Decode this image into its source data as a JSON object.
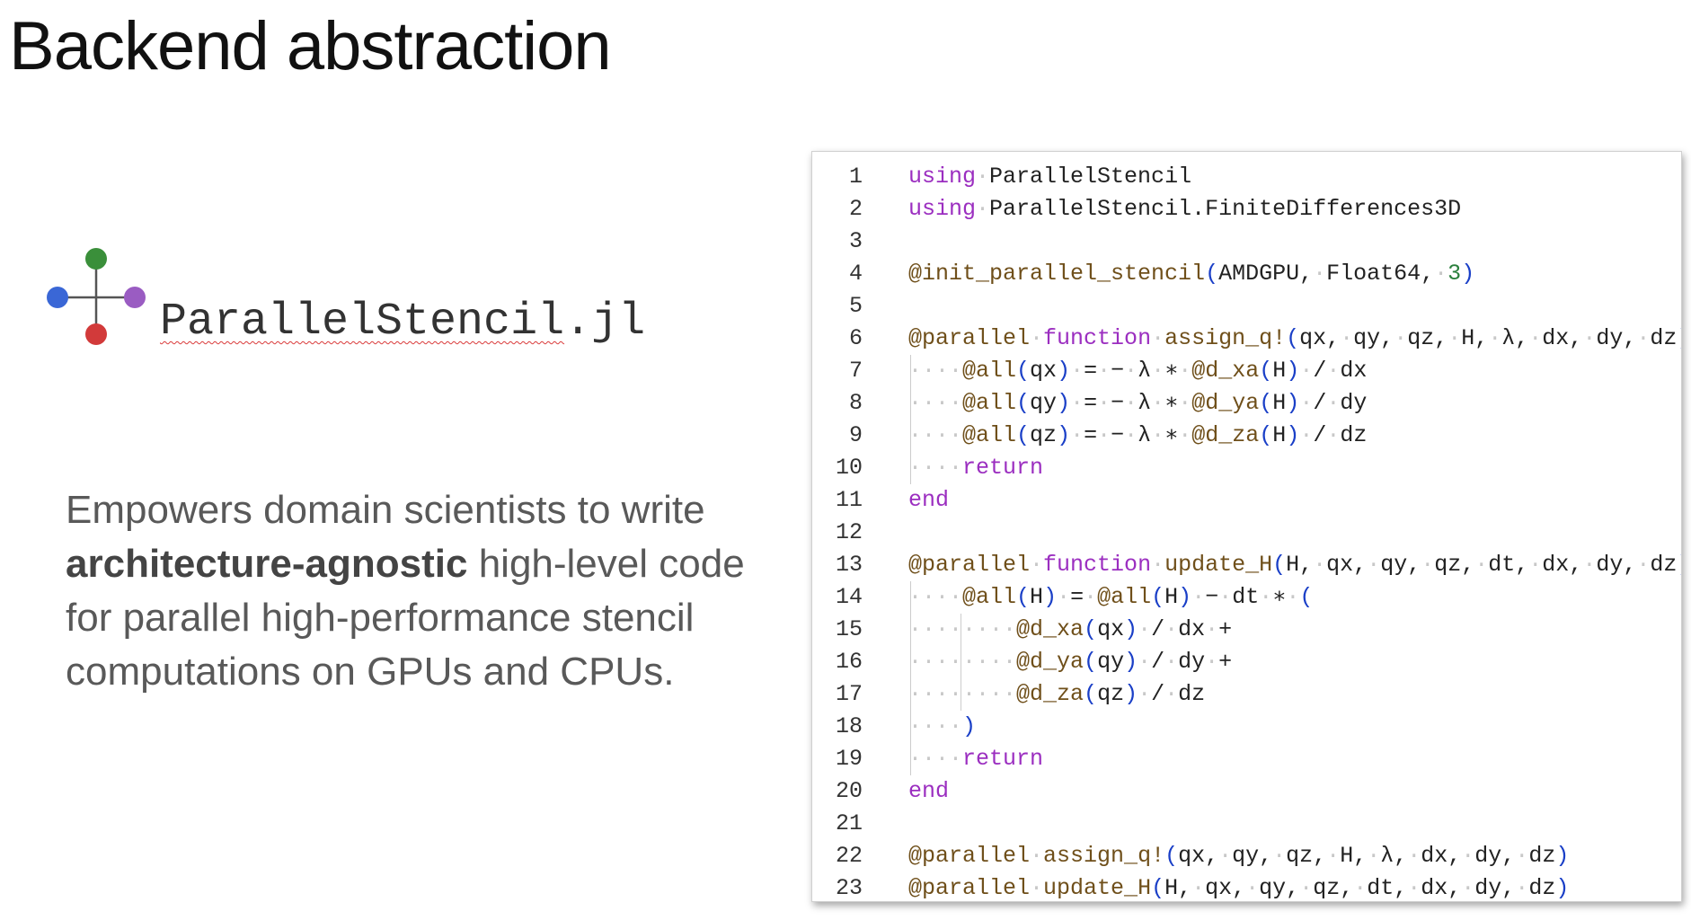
{
  "slide": {
    "title": "Backend abstraction",
    "logo_text_main": "ParallelStencil",
    "logo_text_ext": ".jl",
    "description_pre": "Empowers domain scientists to write ",
    "description_bold": "architecture-agnostic",
    "description_post": " high-level code for parallel high-performance stencil computations on GPUs and CPUs."
  },
  "logo_colors": {
    "top": "#3a8f3a",
    "left": "#3a67d6",
    "right": "#9a5cc2",
    "bottom": "#d23a3a"
  },
  "code": {
    "lines": [
      {
        "n": "1",
        "tokens": [
          [
            "kw",
            "using"
          ],
          [
            "dot",
            "·"
          ],
          [
            "txt",
            "ParallelStencil"
          ]
        ]
      },
      {
        "n": "2",
        "tokens": [
          [
            "kw",
            "using"
          ],
          [
            "dot",
            "·"
          ],
          [
            "txt",
            "ParallelStencil.FiniteDifferences3D"
          ]
        ]
      },
      {
        "n": "3",
        "tokens": []
      },
      {
        "n": "4",
        "tokens": [
          [
            "mac",
            "@init_parallel_stencil"
          ],
          [
            "par",
            "("
          ],
          [
            "txt",
            "AMDGPU,"
          ],
          [
            "dot",
            "·"
          ],
          [
            "txt",
            "Float64,"
          ],
          [
            "dot",
            "·"
          ],
          [
            "num",
            "3"
          ],
          [
            "par",
            ")"
          ]
        ]
      },
      {
        "n": "5",
        "tokens": []
      },
      {
        "n": "6",
        "tokens": [
          [
            "mac",
            "@parallel"
          ],
          [
            "dot",
            "·"
          ],
          [
            "kw",
            "function"
          ],
          [
            "dot",
            "·"
          ],
          [
            "fn",
            "assign_q!"
          ],
          [
            "par",
            "("
          ],
          [
            "txt",
            "qx,"
          ],
          [
            "dot",
            "·"
          ],
          [
            "txt",
            "qy,"
          ],
          [
            "dot",
            "·"
          ],
          [
            "txt",
            "qz,"
          ],
          [
            "dot",
            "·"
          ],
          [
            "txt",
            "H,"
          ],
          [
            "dot",
            "·"
          ],
          [
            "txt",
            "λ,"
          ],
          [
            "dot",
            "·"
          ],
          [
            "txt",
            "dx,"
          ],
          [
            "dot",
            "·"
          ],
          [
            "txt",
            "dy,"
          ],
          [
            "dot",
            "·"
          ],
          [
            "txt",
            "dz"
          ],
          [
            "par",
            ")"
          ]
        ]
      },
      {
        "n": "7",
        "tokens": [
          [
            "dot",
            "····"
          ],
          [
            "mac",
            "@all"
          ],
          [
            "par",
            "("
          ],
          [
            "txt",
            "qx"
          ],
          [
            "par",
            ")"
          ],
          [
            "dot",
            "·"
          ],
          [
            "txt",
            "="
          ],
          [
            "dot",
            "·"
          ],
          [
            "txt",
            "−"
          ],
          [
            "dot",
            "·"
          ],
          [
            "txt",
            "λ"
          ],
          [
            "dot",
            "·"
          ],
          [
            "txt",
            "∗"
          ],
          [
            "dot",
            "·"
          ],
          [
            "mac",
            "@d_xa"
          ],
          [
            "par",
            "("
          ],
          [
            "txt",
            "H"
          ],
          [
            "par",
            ")"
          ],
          [
            "dot",
            "·"
          ],
          [
            "txt",
            "/"
          ],
          [
            "dot",
            "·"
          ],
          [
            "txt",
            "dx"
          ]
        ]
      },
      {
        "n": "8",
        "tokens": [
          [
            "dot",
            "····"
          ],
          [
            "mac",
            "@all"
          ],
          [
            "par",
            "("
          ],
          [
            "txt",
            "qy"
          ],
          [
            "par",
            ")"
          ],
          [
            "dot",
            "·"
          ],
          [
            "txt",
            "="
          ],
          [
            "dot",
            "·"
          ],
          [
            "txt",
            "−"
          ],
          [
            "dot",
            "·"
          ],
          [
            "txt",
            "λ"
          ],
          [
            "dot",
            "·"
          ],
          [
            "txt",
            "∗"
          ],
          [
            "dot",
            "·"
          ],
          [
            "mac",
            "@d_ya"
          ],
          [
            "par",
            "("
          ],
          [
            "txt",
            "H"
          ],
          [
            "par",
            ")"
          ],
          [
            "dot",
            "·"
          ],
          [
            "txt",
            "/"
          ],
          [
            "dot",
            "·"
          ],
          [
            "txt",
            "dy"
          ]
        ]
      },
      {
        "n": "9",
        "tokens": [
          [
            "dot",
            "····"
          ],
          [
            "mac",
            "@all"
          ],
          [
            "par",
            "("
          ],
          [
            "txt",
            "qz"
          ],
          [
            "par",
            ")"
          ],
          [
            "dot",
            "·"
          ],
          [
            "txt",
            "="
          ],
          [
            "dot",
            "·"
          ],
          [
            "txt",
            "−"
          ],
          [
            "dot",
            "·"
          ],
          [
            "txt",
            "λ"
          ],
          [
            "dot",
            "·"
          ],
          [
            "txt",
            "∗"
          ],
          [
            "dot",
            "·"
          ],
          [
            "mac",
            "@d_za"
          ],
          [
            "par",
            "("
          ],
          [
            "txt",
            "H"
          ],
          [
            "par",
            ")"
          ],
          [
            "dot",
            "·"
          ],
          [
            "txt",
            "/"
          ],
          [
            "dot",
            "·"
          ],
          [
            "txt",
            "dz"
          ]
        ]
      },
      {
        "n": "10",
        "tokens": [
          [
            "dot",
            "····"
          ],
          [
            "kw",
            "return"
          ]
        ]
      },
      {
        "n": "11",
        "tokens": [
          [
            "kw",
            "end"
          ]
        ]
      },
      {
        "n": "12",
        "tokens": []
      },
      {
        "n": "13",
        "tokens": [
          [
            "mac",
            "@parallel"
          ],
          [
            "dot",
            "·"
          ],
          [
            "kw",
            "function"
          ],
          [
            "dot",
            "·"
          ],
          [
            "fn",
            "update_H"
          ],
          [
            "par",
            "("
          ],
          [
            "txt",
            "H,"
          ],
          [
            "dot",
            "·"
          ],
          [
            "txt",
            "qx,"
          ],
          [
            "dot",
            "·"
          ],
          [
            "txt",
            "qy,"
          ],
          [
            "dot",
            "·"
          ],
          [
            "txt",
            "qz,"
          ],
          [
            "dot",
            "·"
          ],
          [
            "txt",
            "dt,"
          ],
          [
            "dot",
            "·"
          ],
          [
            "txt",
            "dx,"
          ],
          [
            "dot",
            "·"
          ],
          [
            "txt",
            "dy,"
          ],
          [
            "dot",
            "·"
          ],
          [
            "txt",
            "dz"
          ],
          [
            "par",
            ")"
          ]
        ]
      },
      {
        "n": "14",
        "tokens": [
          [
            "dot",
            "····"
          ],
          [
            "mac",
            "@all"
          ],
          [
            "par",
            "("
          ],
          [
            "txt",
            "H"
          ],
          [
            "par",
            ")"
          ],
          [
            "dot",
            "·"
          ],
          [
            "txt",
            "="
          ],
          [
            "dot",
            "·"
          ],
          [
            "mac",
            "@all"
          ],
          [
            "par",
            "("
          ],
          [
            "txt",
            "H"
          ],
          [
            "par",
            ")"
          ],
          [
            "dot",
            "·"
          ],
          [
            "txt",
            "−"
          ],
          [
            "dot",
            "·"
          ],
          [
            "txt",
            "dt"
          ],
          [
            "dot",
            "·"
          ],
          [
            "txt",
            "∗"
          ],
          [
            "dot",
            "·"
          ],
          [
            "par",
            "("
          ]
        ]
      },
      {
        "n": "15",
        "tokens": [
          [
            "dot",
            "········"
          ],
          [
            "mac",
            "@d_xa"
          ],
          [
            "par",
            "("
          ],
          [
            "txt",
            "qx"
          ],
          [
            "par",
            ")"
          ],
          [
            "dot",
            "·"
          ],
          [
            "txt",
            "/"
          ],
          [
            "dot",
            "·"
          ],
          [
            "txt",
            "dx"
          ],
          [
            "dot",
            "·"
          ],
          [
            "txt",
            "+"
          ]
        ]
      },
      {
        "n": "16",
        "tokens": [
          [
            "dot",
            "········"
          ],
          [
            "mac",
            "@d_ya"
          ],
          [
            "par",
            "("
          ],
          [
            "txt",
            "qy"
          ],
          [
            "par",
            ")"
          ],
          [
            "dot",
            "·"
          ],
          [
            "txt",
            "/"
          ],
          [
            "dot",
            "·"
          ],
          [
            "txt",
            "dy"
          ],
          [
            "dot",
            "·"
          ],
          [
            "txt",
            "+"
          ]
        ]
      },
      {
        "n": "17",
        "tokens": [
          [
            "dot",
            "········"
          ],
          [
            "mac",
            "@d_za"
          ],
          [
            "par",
            "("
          ],
          [
            "txt",
            "qz"
          ],
          [
            "par",
            ")"
          ],
          [
            "dot",
            "·"
          ],
          [
            "txt",
            "/"
          ],
          [
            "dot",
            "·"
          ],
          [
            "txt",
            "dz"
          ]
        ]
      },
      {
        "n": "18",
        "tokens": [
          [
            "dot",
            "····"
          ],
          [
            "par",
            ")"
          ]
        ]
      },
      {
        "n": "19",
        "tokens": [
          [
            "dot",
            "····"
          ],
          [
            "kw",
            "return"
          ]
        ]
      },
      {
        "n": "20",
        "tokens": [
          [
            "kw",
            "end"
          ]
        ]
      },
      {
        "n": "21",
        "tokens": []
      },
      {
        "n": "22",
        "tokens": [
          [
            "mac",
            "@parallel"
          ],
          [
            "dot",
            "·"
          ],
          [
            "fn",
            "assign_q!"
          ],
          [
            "par",
            "("
          ],
          [
            "txt",
            "qx,"
          ],
          [
            "dot",
            "·"
          ],
          [
            "txt",
            "qy,"
          ],
          [
            "dot",
            "·"
          ],
          [
            "txt",
            "qz,"
          ],
          [
            "dot",
            "·"
          ],
          [
            "txt",
            "H,"
          ],
          [
            "dot",
            "·"
          ],
          [
            "txt",
            "λ,"
          ],
          [
            "dot",
            "·"
          ],
          [
            "txt",
            "dx,"
          ],
          [
            "dot",
            "·"
          ],
          [
            "txt",
            "dy,"
          ],
          [
            "dot",
            "·"
          ],
          [
            "txt",
            "dz"
          ],
          [
            "par",
            ")"
          ]
        ]
      },
      {
        "n": "23",
        "tokens": [
          [
            "mac",
            "@parallel"
          ],
          [
            "dot",
            "·"
          ],
          [
            "fn",
            "update_H"
          ],
          [
            "par",
            "("
          ],
          [
            "txt",
            "H,"
          ],
          [
            "dot",
            "·"
          ],
          [
            "txt",
            "qx,"
          ],
          [
            "dot",
            "·"
          ],
          [
            "txt",
            "qy,"
          ],
          [
            "dot",
            "·"
          ],
          [
            "txt",
            "qz,"
          ],
          [
            "dot",
            "·"
          ],
          [
            "txt",
            "dt,"
          ],
          [
            "dot",
            "·"
          ],
          [
            "txt",
            "dx,"
          ],
          [
            "dot",
            "·"
          ],
          [
            "txt",
            "dy,"
          ],
          [
            "dot",
            "·"
          ],
          [
            "txt",
            "dz"
          ],
          [
            "par",
            ")"
          ]
        ]
      }
    ]
  }
}
